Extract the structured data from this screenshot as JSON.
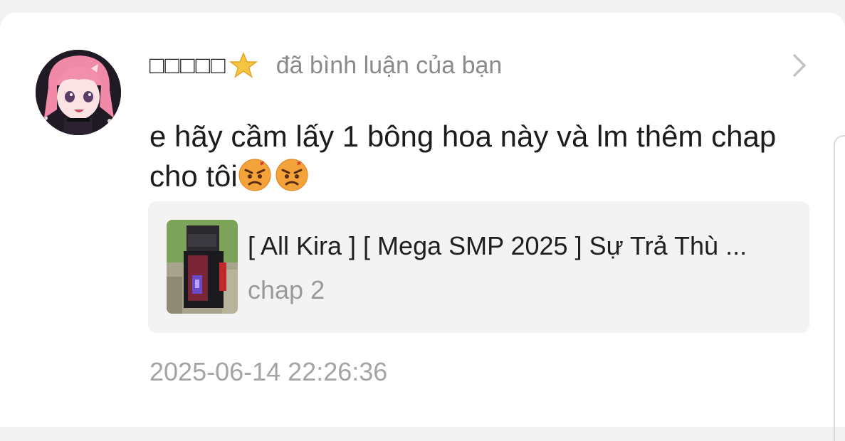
{
  "notification": {
    "username": "□□□□□",
    "username_badge_icon": "star-icon",
    "action_text": "đã bình luận của bạn",
    "comment_text": "e hãy cầm lấy 1 bông hoa này và lm thêm chap cho tôi",
    "comment_emojis": [
      "angry-face-emoji",
      "angry-face-emoji"
    ],
    "reference": {
      "title": "[ All Kira ] [ Mega SMP 2025 ] Sự Trả Thù ...",
      "chapter": "chap 2"
    },
    "timestamp": "2025-06-14 22:26:36"
  },
  "colors": {
    "background": "#f2f2f2",
    "card": "#ffffff",
    "reference_box": "#f3f3f3",
    "muted_text": "#8b8b8b",
    "emoji": "#f4a23a"
  }
}
